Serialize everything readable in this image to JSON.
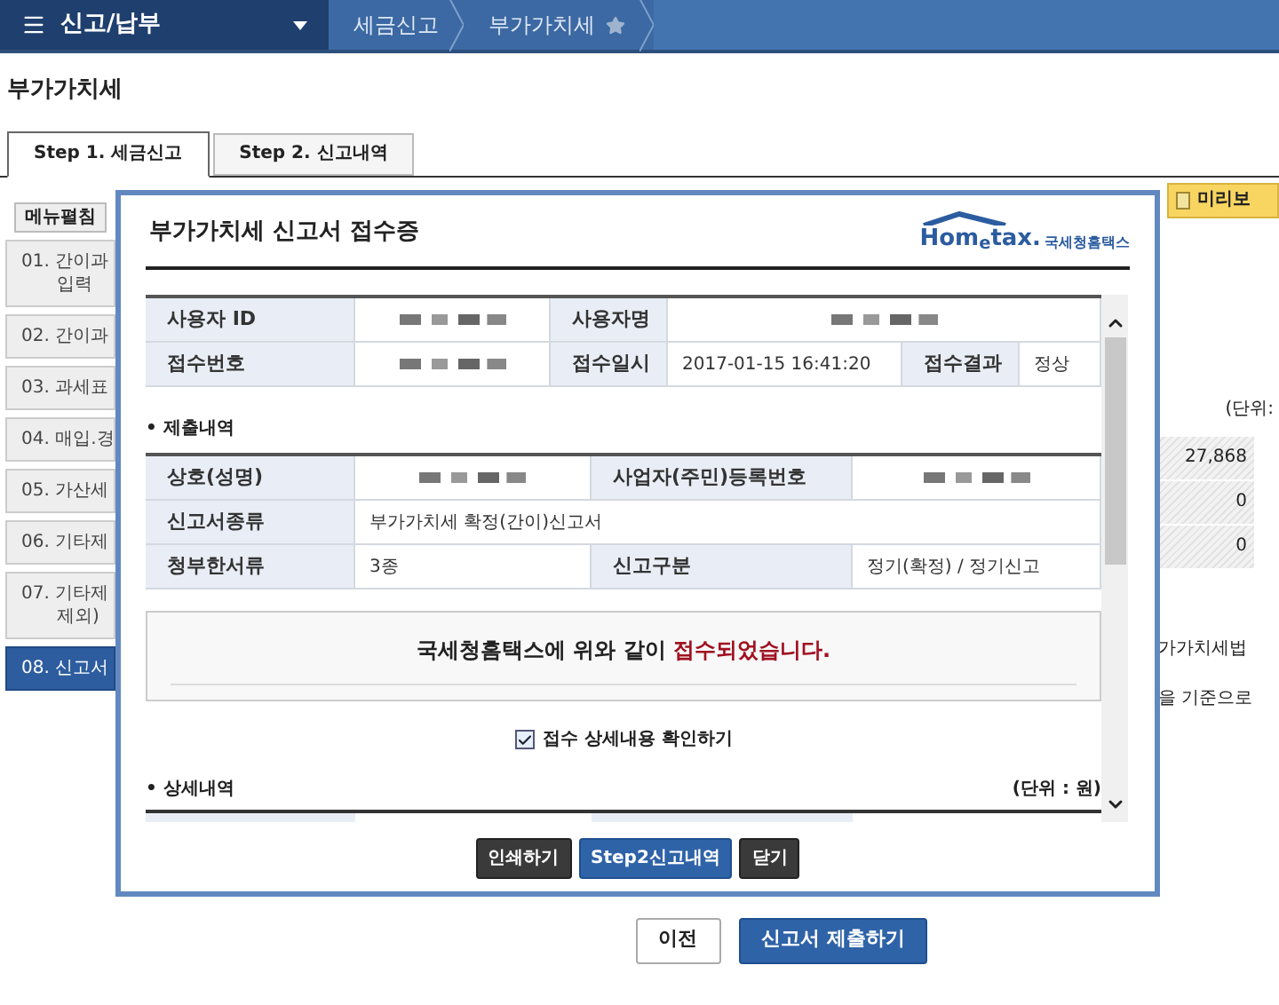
{
  "top_bar": {
    "title": "신고/납부",
    "breadcrumbs": [
      "세금신고",
      "부가가치세"
    ]
  },
  "page_title": "부가가치세",
  "tabs": [
    {
      "label": "Step 1. 세금신고",
      "selected": true
    },
    {
      "label": "Step 2. 신고내역",
      "selected": false
    }
  ],
  "side_menu": {
    "toggle": "메뉴펼침",
    "items": [
      {
        "lines": [
          "01. 간이과",
          "입력"
        ],
        "selected": false
      },
      {
        "lines": [
          "02. 간이과"
        ],
        "selected": false
      },
      {
        "lines": [
          "03. 과세표"
        ],
        "selected": false
      },
      {
        "lines": [
          "04. 매입.경"
        ],
        "selected": false
      },
      {
        "lines": [
          "05. 가산세"
        ],
        "selected": false
      },
      {
        "lines": [
          "06. 기타제"
        ],
        "selected": false
      },
      {
        "lines": [
          "07. 기타제",
          "제외)"
        ],
        "selected": false
      },
      {
        "lines": [
          "08. 신고서"
        ],
        "selected": true
      }
    ]
  },
  "right_panel": {
    "preview_button": "미리보",
    "unit": "(단위:",
    "values": [
      "27,868",
      "0",
      "0"
    ],
    "notes": [
      "가가치세법",
      "을 기준으로"
    ]
  },
  "modal": {
    "title": "부가가치세 신고서 접수증",
    "logo": {
      "wordmark": "Hom$_{e}$tax.",
      "name": "국세청홈택스"
    },
    "summary_rows": [
      [
        {
          "kind": "label",
          "text": "사용자 ID"
        },
        {
          "kind": "redacted"
        },
        {
          "kind": "label",
          "text": "사용자명"
        },
        {
          "kind": "redacted"
        }
      ],
      [
        {
          "kind": "label",
          "text": "접수번호"
        },
        {
          "kind": "redacted"
        },
        {
          "kind": "label",
          "text": "접수일시"
        },
        {
          "kind": "value",
          "text": "2017-01-15 16:41:20"
        },
        {
          "kind": "label",
          "text": "접수결과"
        },
        {
          "kind": "value",
          "text": "정상"
        }
      ]
    ],
    "submission": {
      "heading": "• 제출내역",
      "rows": [
        [
          {
            "kind": "label",
            "text": "상호(성명)"
          },
          {
            "kind": "redacted"
          },
          {
            "kind": "label",
            "text": "사업자(주민)등록번호"
          },
          {
            "kind": "redacted"
          }
        ],
        [
          {
            "kind": "label",
            "text": "신고서종류"
          },
          {
            "kind": "value",
            "text": "부가가치세 확정(간이)신고서"
          }
        ],
        [
          {
            "kind": "label",
            "text": "청부한서류"
          },
          {
            "kind": "value",
            "text": "3종"
          },
          {
            "kind": "label",
            "text": "신고구분"
          },
          {
            "kind": "value",
            "text": "정기(확정) / 정기신고"
          }
        ]
      ]
    },
    "message": "국세청홈택스에 위와 같이 **접수되었습니다.**",
    "confirm": {
      "label": "접수 상세내용 확인하기",
      "checked": true
    },
    "details": {
      "heading": "• 상세내역",
      "unit": "(단위 : 원)"
    },
    "buttons": [
      {
        "label": "인쇄하기",
        "kind": "dark"
      },
      {
        "label": "Step2신고내역",
        "kind": "primary"
      },
      {
        "label": "닫기",
        "kind": "dark"
      }
    ]
  },
  "footer_buttons": [
    {
      "label": "이전",
      "kind": "default"
    },
    {
      "label": "신고서 제출하기",
      "kind": "primary"
    }
  ]
}
